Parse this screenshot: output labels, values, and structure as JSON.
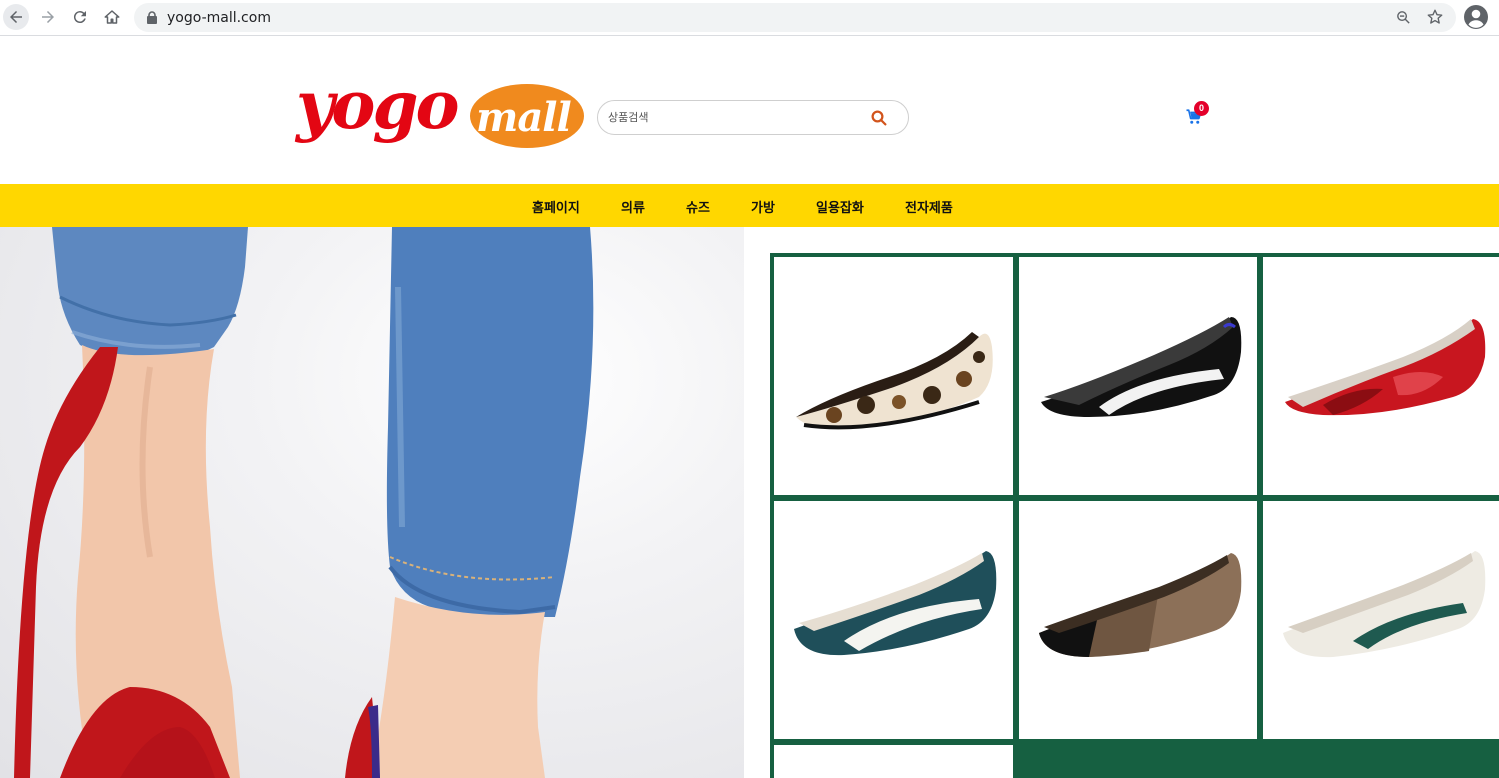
{
  "browser": {
    "url": "yogo-mall.com",
    "icons": [
      "back-arrow-icon",
      "forward-arrow-icon",
      "reload-icon",
      "home-icon",
      "lock-icon",
      "zoom-icon",
      "star-icon",
      "account-icon"
    ]
  },
  "header": {
    "logo_primary": "yogo",
    "logo_secondary": "mall",
    "search_placeholder": "상품검색",
    "cart_count": "0"
  },
  "menu": {
    "items": [
      {
        "label": "홈페이지"
      },
      {
        "label": "의류"
      },
      {
        "label": "슈즈"
      },
      {
        "label": "가방"
      },
      {
        "label": "일용잡화"
      },
      {
        "label": "전자제품"
      }
    ]
  },
  "colors": {
    "menu_bg": "#ffd700",
    "logo_red": "#e30613",
    "logo_orange": "#f08a1e",
    "grid_green": "#166041",
    "search_icon": "#d2541c",
    "cart_icon": "#1a73e8"
  },
  "banner": {
    "products": [
      {
        "name": "leopard-flat"
      },
      {
        "name": "black-white-stripe-flat"
      },
      {
        "name": "red-camo-flat"
      },
      {
        "name": "teal-white-stripe-flat"
      },
      {
        "name": "black-brown-flat"
      },
      {
        "name": "cream-green-stripe-flat"
      }
    ]
  }
}
